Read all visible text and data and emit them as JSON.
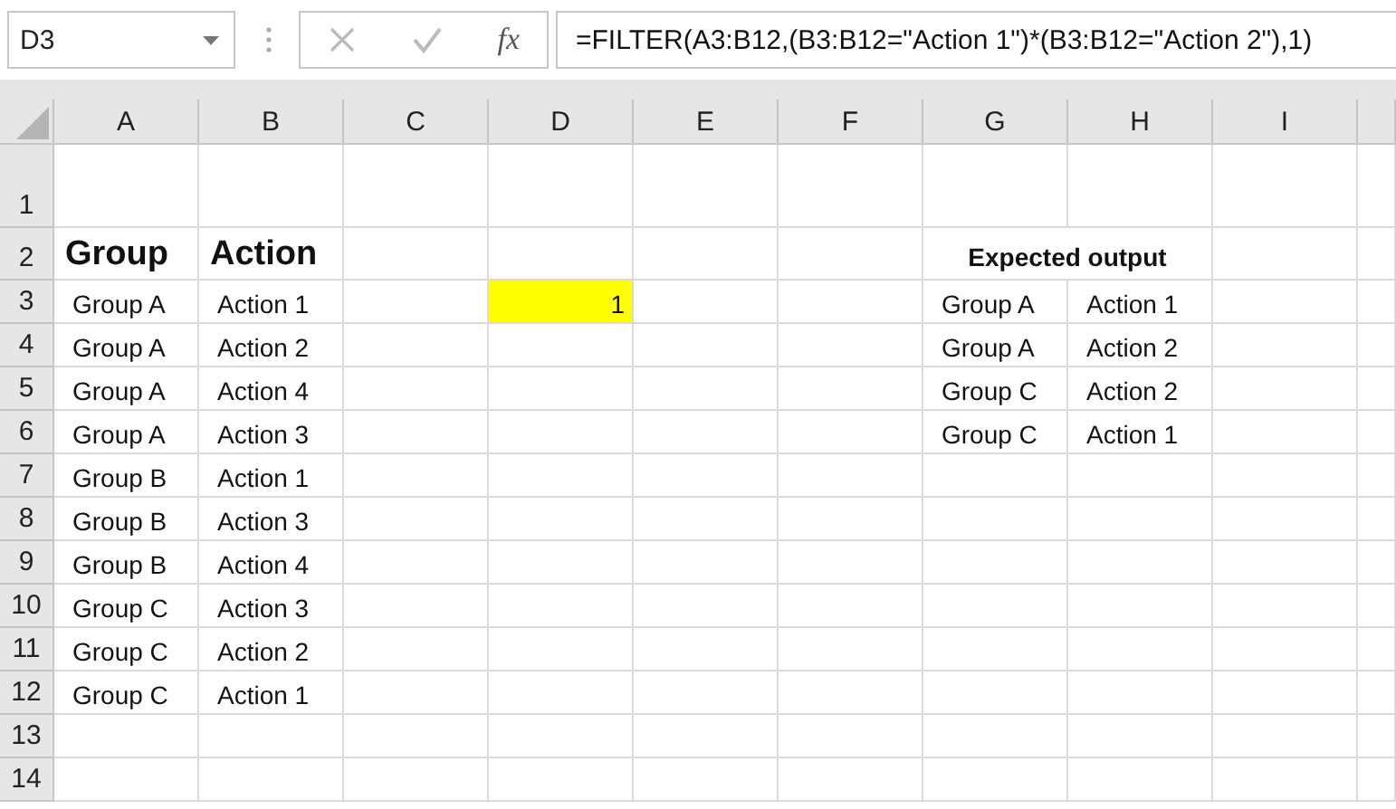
{
  "name_box": {
    "value": "D3"
  },
  "formula_bar": {
    "function_label": "fx",
    "value": "=FILTER(A3:B12,(B3:B12=\"Action 1\")*(B3:B12=\"Action 2\"),1)"
  },
  "columns": [
    "A",
    "B",
    "C",
    "D",
    "E",
    "F",
    "G",
    "H",
    "I"
  ],
  "rows": [
    {
      "label": "1",
      "cells": {}
    },
    {
      "label": "2",
      "cells": {
        "A": {
          "kind": "heading",
          "text": "Group"
        },
        "B": {
          "kind": "heading",
          "text": "Action"
        },
        "G": {
          "kind": "title",
          "text": "Expected output"
        }
      }
    },
    {
      "label": "3",
      "cells": {
        "A": {
          "kind": "value",
          "text": "Group A"
        },
        "B": {
          "kind": "value",
          "text": "Action 1"
        },
        "D": {
          "kind": "number",
          "text": "1",
          "highlighted": true
        },
        "G": {
          "kind": "value",
          "text": "Group A"
        },
        "H": {
          "kind": "value",
          "text": "Action 1"
        }
      }
    },
    {
      "label": "4",
      "cells": {
        "A": {
          "kind": "value",
          "text": "Group A"
        },
        "B": {
          "kind": "value",
          "text": "Action 2"
        },
        "G": {
          "kind": "value",
          "text": "Group A"
        },
        "H": {
          "kind": "value",
          "text": "Action 2"
        }
      }
    },
    {
      "label": "5",
      "cells": {
        "A": {
          "kind": "value",
          "text": "Group A"
        },
        "B": {
          "kind": "value",
          "text": "Action 4"
        },
        "G": {
          "kind": "value",
          "text": "Group C"
        },
        "H": {
          "kind": "value",
          "text": "Action 2"
        }
      }
    },
    {
      "label": "6",
      "cells": {
        "A": {
          "kind": "value",
          "text": "Group A"
        },
        "B": {
          "kind": "value",
          "text": "Action 3"
        },
        "G": {
          "kind": "value",
          "text": "Group C"
        },
        "H": {
          "kind": "value",
          "text": "Action 1"
        }
      }
    },
    {
      "label": "7",
      "cells": {
        "A": {
          "kind": "value",
          "text": "Group B"
        },
        "B": {
          "kind": "value",
          "text": "Action 1"
        }
      }
    },
    {
      "label": "8",
      "cells": {
        "A": {
          "kind": "value",
          "text": "Group B"
        },
        "B": {
          "kind": "value",
          "text": "Action 3"
        }
      }
    },
    {
      "label": "9",
      "cells": {
        "A": {
          "kind": "value",
          "text": "Group B"
        },
        "B": {
          "kind": "value",
          "text": "Action 4"
        }
      }
    },
    {
      "label": "10",
      "cells": {
        "A": {
          "kind": "value",
          "text": "Group C"
        },
        "B": {
          "kind": "value",
          "text": "Action 3"
        }
      }
    },
    {
      "label": "11",
      "cells": {
        "A": {
          "kind": "value",
          "text": "Group C"
        },
        "B": {
          "kind": "value",
          "text": "Action 2"
        }
      }
    },
    {
      "label": "12",
      "cells": {
        "A": {
          "kind": "value",
          "text": "Group C"
        },
        "B": {
          "kind": "value",
          "text": "Action 1"
        }
      }
    },
    {
      "label": "13",
      "cells": {}
    },
    {
      "label": "14",
      "cells": {}
    }
  ]
}
